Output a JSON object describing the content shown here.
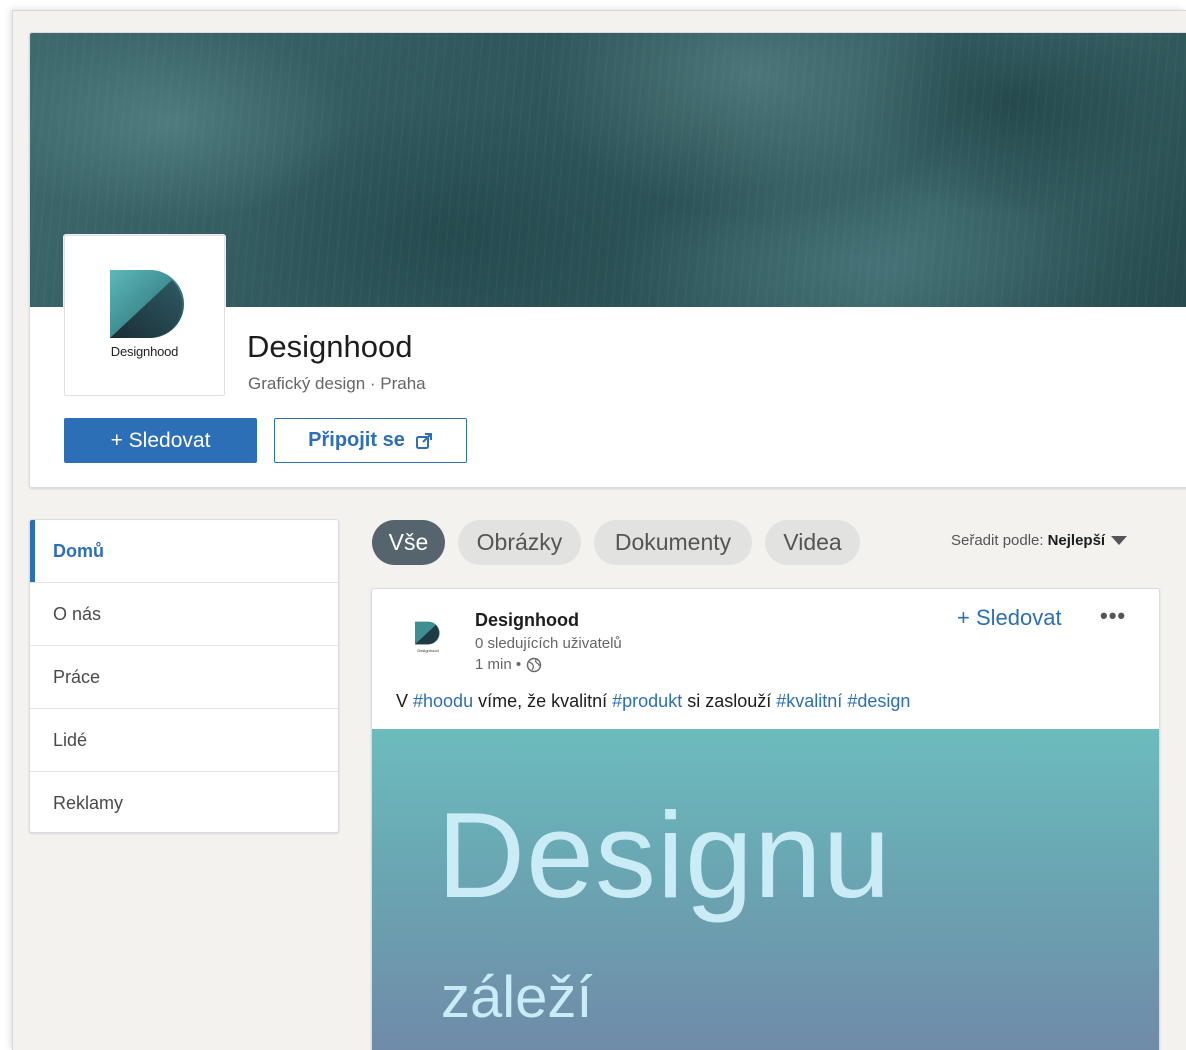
{
  "company": {
    "logo_text": "Designhood",
    "name": "Designhood",
    "subtitle": "Grafický design · Praha"
  },
  "actions": {
    "follow_label": "+ Sledovat",
    "connect_label": "Připojit se"
  },
  "nav": {
    "items": [
      {
        "label": "Domů",
        "active": true
      },
      {
        "label": "O nás",
        "active": false
      },
      {
        "label": "Práce",
        "active": false
      },
      {
        "label": "Lidé",
        "active": false
      },
      {
        "label": "Reklamy",
        "active": false
      }
    ]
  },
  "filters": {
    "pills": [
      {
        "label": "Vše",
        "active": true
      },
      {
        "label": "Obrázky",
        "active": false
      },
      {
        "label": "Dokumenty",
        "active": false
      },
      {
        "label": "Videa",
        "active": false
      }
    ],
    "sort_label": "Seřadit podle:",
    "sort_value": "Nejlepší"
  },
  "post": {
    "logo_text": "Designhood",
    "author": "Designhood",
    "followers": "0 sledujících uživatelů",
    "time": "1 min •",
    "follow_label": "+ Sledovat",
    "more_label": "•••",
    "text": {
      "p1": "V ",
      "tag1": "#hoodu",
      "p2": " víme, že kvalitní ",
      "tag2": "#produkt",
      "p3": " si zaslouží ",
      "tag3": "#kvalitní",
      "p4": " ",
      "tag4": "#design"
    },
    "image_title": "Designu",
    "image_subtitle": "záleží"
  },
  "icons": {
    "external_link": "external-link-icon",
    "globe": "globe-icon",
    "caret": "caret-down-icon"
  },
  "colors": {
    "accent": "#2d6fb6",
    "pill_active": "#56646d",
    "pill_inactive": "#e2e2e0",
    "cover": "#2f575b"
  }
}
